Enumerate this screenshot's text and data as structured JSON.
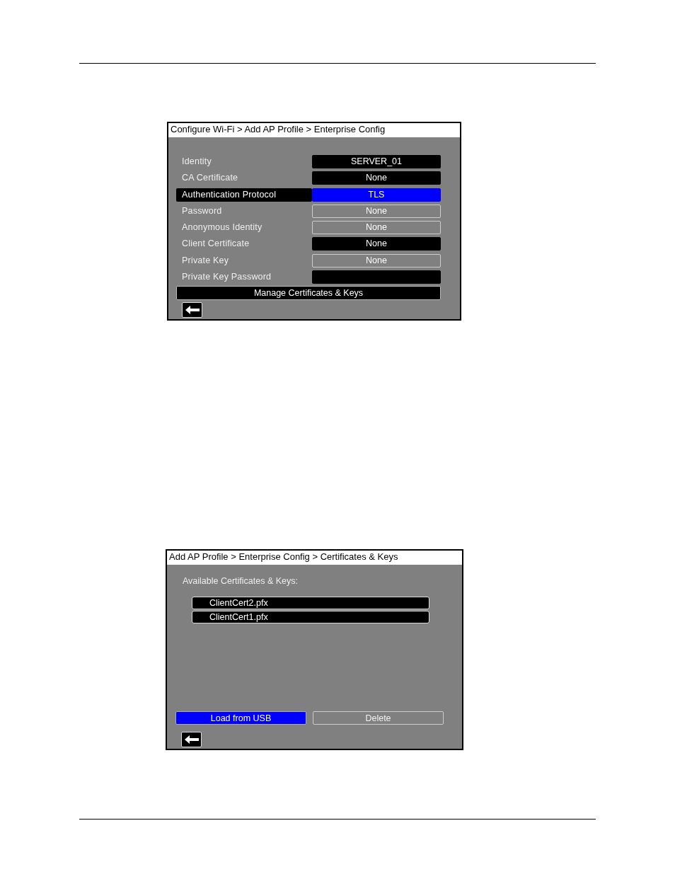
{
  "config_screen": {
    "title": "Configure Wi-Fi > Add AP Profile > Enterprise Config",
    "fields": [
      {
        "label": "Identity",
        "value": "SERVER_01",
        "selected": false,
        "disabled": false
      },
      {
        "label": "CA Certificate",
        "value": "None",
        "selected": false,
        "disabled": false
      },
      {
        "label": "Authentication Protocol",
        "value": "TLS",
        "selected": true,
        "disabled": false
      },
      {
        "label": "Password",
        "value": "None",
        "selected": false,
        "disabled": true
      },
      {
        "label": "Anonymous Identity",
        "value": "None",
        "selected": false,
        "disabled": true
      },
      {
        "label": "Client Certificate",
        "value": "None",
        "selected": false,
        "disabled": false
      },
      {
        "label": "Private Key",
        "value": "None",
        "selected": false,
        "disabled": true
      },
      {
        "label": "Private Key Password",
        "selected": false,
        "disabled": false
      }
    ],
    "manage_button": "Manage Certificates & Keys"
  },
  "certs_screen": {
    "title": "Add AP Profile > Enterprise Config > Certificates & Keys",
    "list_label": "Available Certificates & Keys:",
    "files": [
      "ClientCert2.pfx",
      "ClientCert1.pfx"
    ],
    "buttons": [
      {
        "label": "Load from USB",
        "selected": true,
        "disabled": false
      },
      {
        "label": "Delete",
        "selected": false,
        "disabled": true
      }
    ]
  }
}
